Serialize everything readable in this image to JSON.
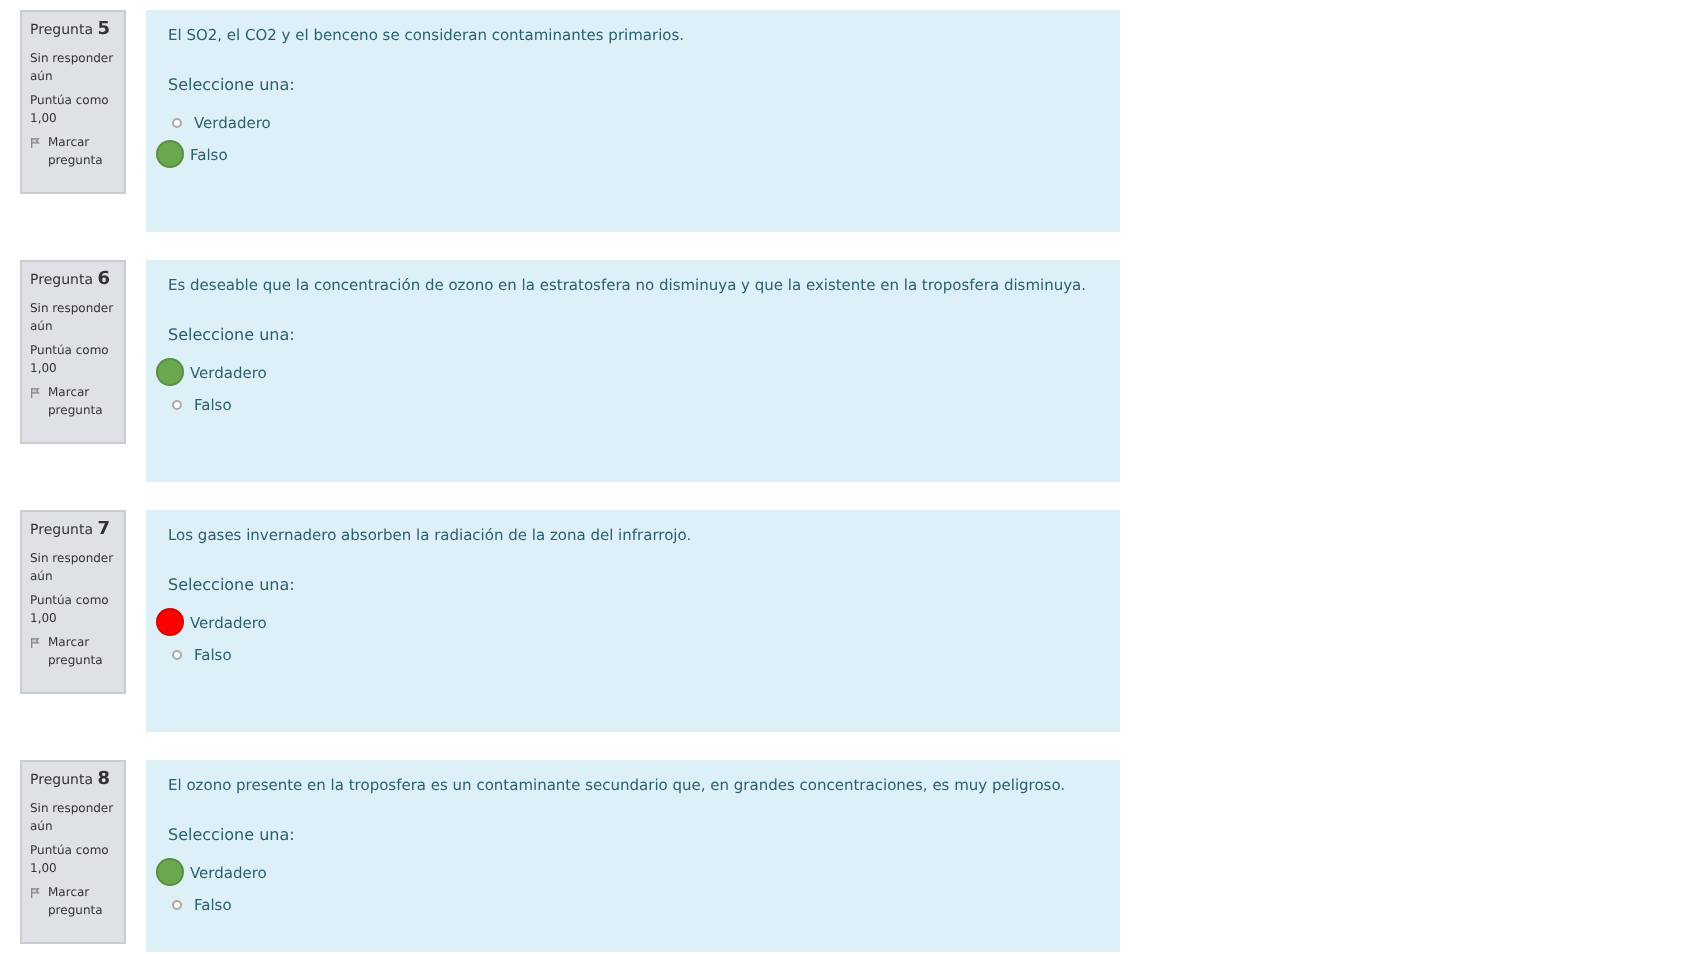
{
  "questions": [
    {
      "number": "Pregunta **5**",
      "status": "Sin responder aún",
      "points": "Puntúa como 1,00",
      "flag": "Marcar pregunta",
      "text": "El SO2, el CO2 y el benceno se consideran contaminantes primarios.",
      "prompt": "Seleccione una:",
      "options": [
        {
          "label": "Verdadero",
          "selected": false
        },
        {
          "label": "Falso",
          "selected": true,
          "color": "#6aa84f"
        }
      ]
    },
    {
      "number": "Pregunta **6**",
      "status": "Sin responder aún",
      "points": "Puntúa como 1,00",
      "flag": "Marcar pregunta",
      "text": "Es deseable que la concentración de ozono en la estratosfera no disminuya y que la existente en la troposfera disminuya.",
      "prompt": "Seleccione una:",
      "options": [
        {
          "label": "Verdadero",
          "selected": true,
          "color": "#6aa84f"
        },
        {
          "label": "Falso",
          "selected": false
        }
      ]
    },
    {
      "number": "Pregunta **7**",
      "status": "Sin responder aún",
      "points": "Puntúa como 1,00",
      "flag": "Marcar pregunta",
      "text": "Los gases invernadero absorben la radiación de la zona del infrarrojo.",
      "prompt": "Seleccione una:",
      "options": [
        {
          "label": "Verdadero",
          "selected": true,
          "color": "#ff0000"
        },
        {
          "label": "Falso",
          "selected": false
        }
      ]
    },
    {
      "number": "Pregunta **8**",
      "status": "Sin responder aún",
      "points": "Puntúa como 1,00",
      "flag": "Marcar pregunta",
      "text": "El ozono presente en la troposfera es un contaminante secundario que, en grandes concentraciones, es muy peligroso.",
      "prompt": "Seleccione una:",
      "options": [
        {
          "label": "Verdadero",
          "selected": true,
          "color": "#6aa84f"
        },
        {
          "label": "Falso",
          "selected": false
        }
      ]
    }
  ]
}
